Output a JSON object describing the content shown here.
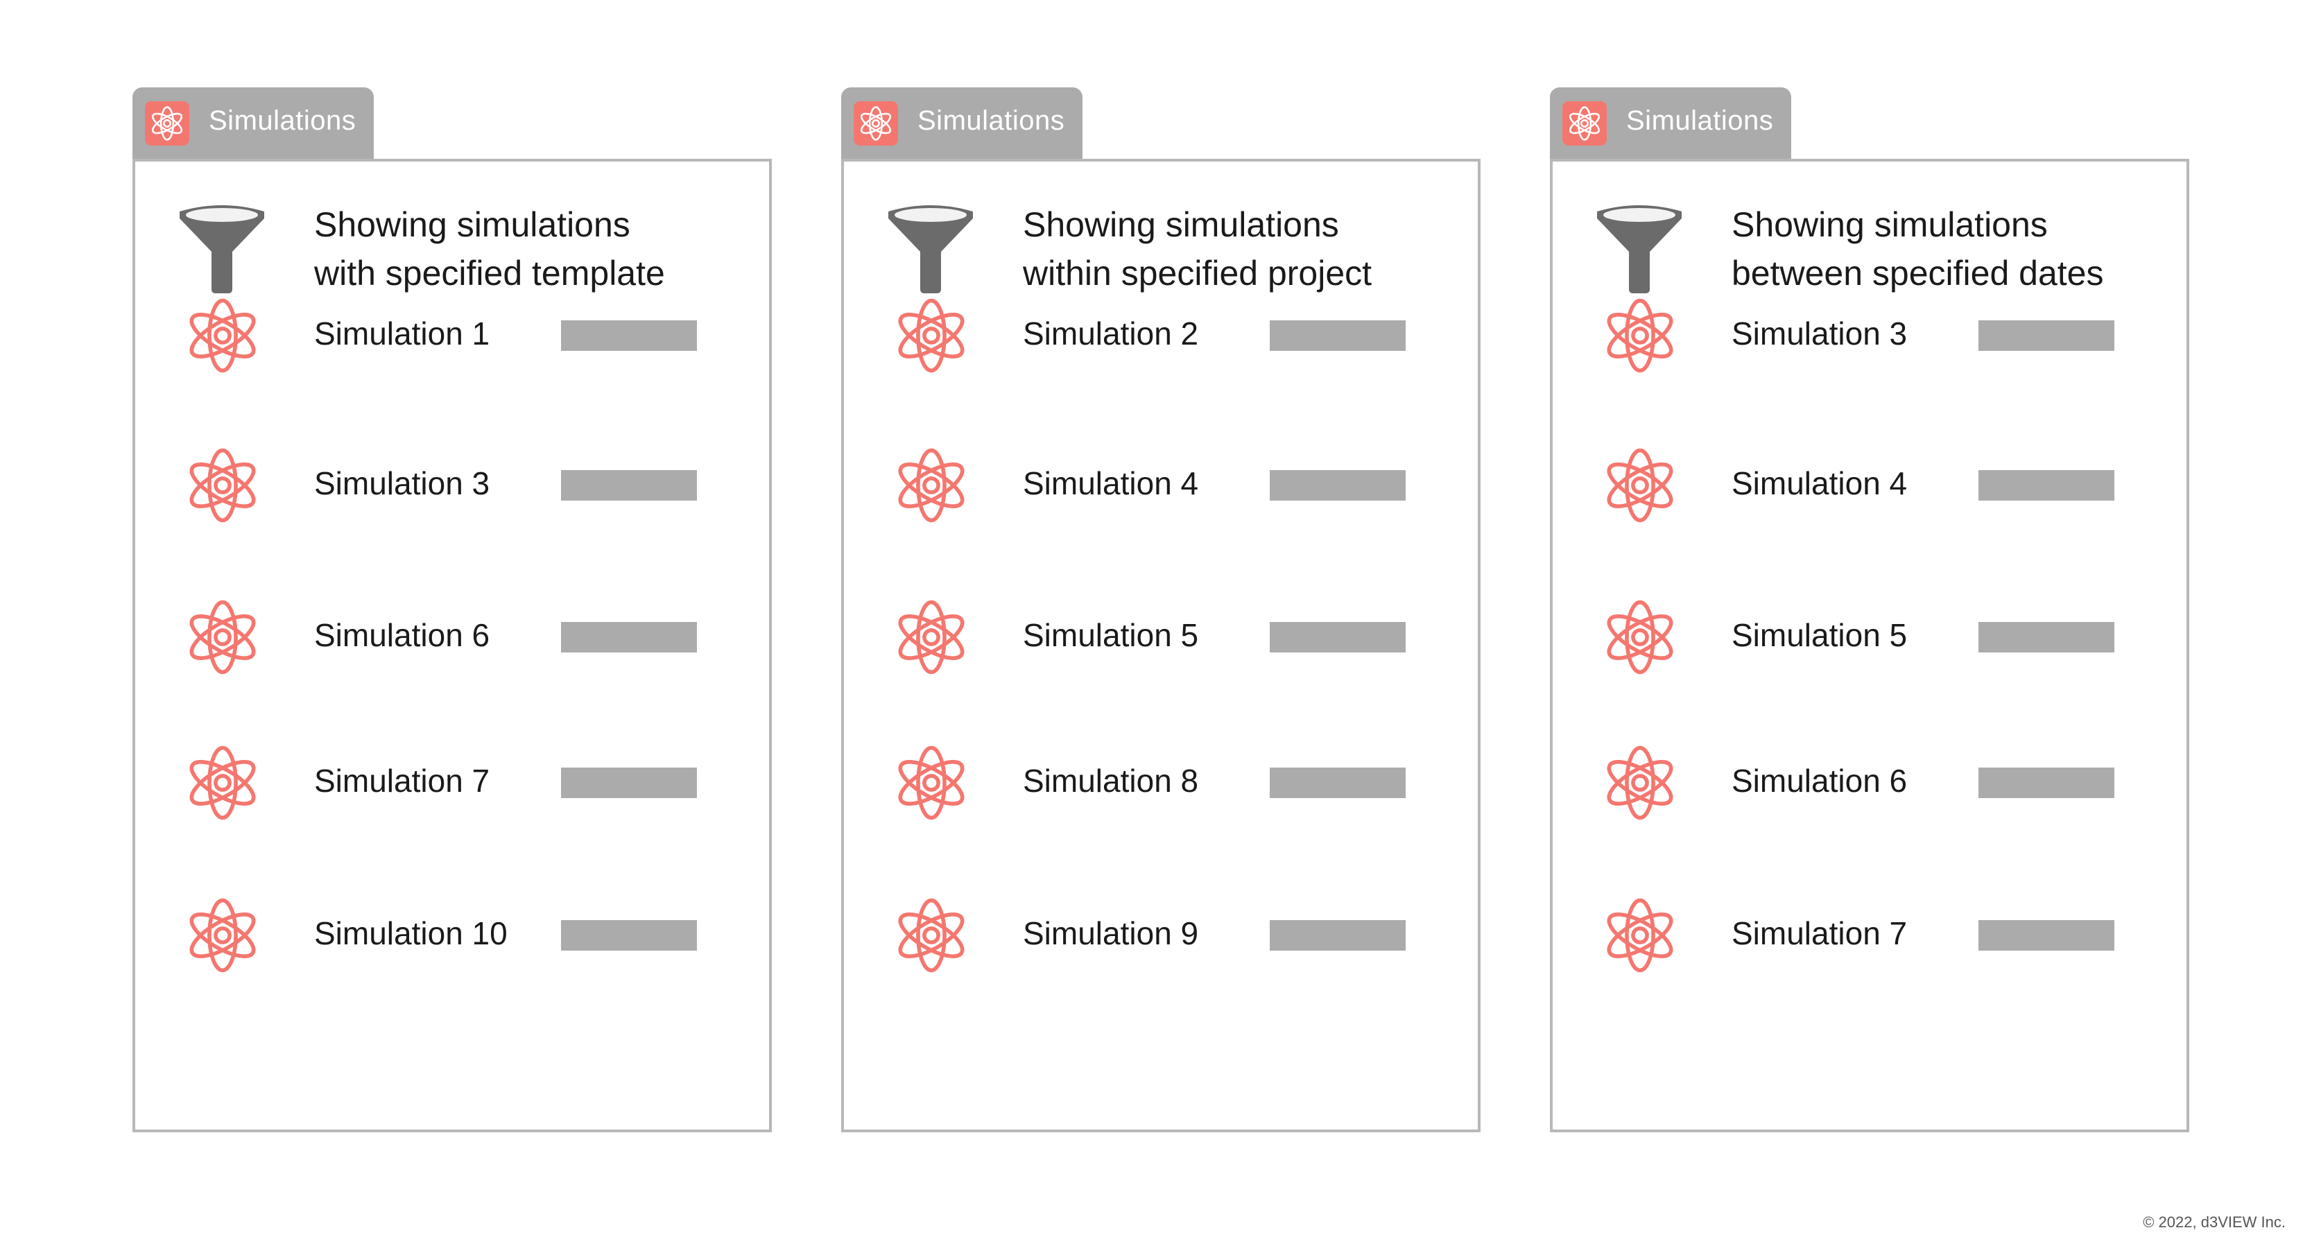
{
  "colors": {
    "accent": "#f4776f",
    "atom": "#f4776f",
    "tab_bg": "#ababab",
    "border": "#b8b8b8",
    "bar": "#ababab",
    "funnel": "#6b6b6b"
  },
  "icons": {
    "tab": "atom-icon",
    "filter": "funnel-icon",
    "row": "atom-icon"
  },
  "panels": [
    {
      "tab_label": "Simulations",
      "filter_line1": "Showing simulations",
      "filter_line2": "with specified template",
      "simulations": [
        "Simulation 1",
        "Simulation 3",
        "Simulation 6",
        "Simulation 7",
        "Simulation 10"
      ]
    },
    {
      "tab_label": "Simulations",
      "filter_line1": "Showing simulations",
      "filter_line2": "within specified project",
      "simulations": [
        "Simulation 2",
        "Simulation 4",
        "Simulation 5",
        "Simulation 8",
        "Simulation 9"
      ]
    },
    {
      "tab_label": "Simulations",
      "filter_line1": "Showing simulations",
      "filter_line2": "between specified dates",
      "simulations": [
        "Simulation 3",
        "Simulation 4",
        "Simulation 5",
        "Simulation 6",
        "Simulation 7"
      ]
    }
  ],
  "footer": {
    "copyright": "© 2022, d3VIEW Inc."
  }
}
